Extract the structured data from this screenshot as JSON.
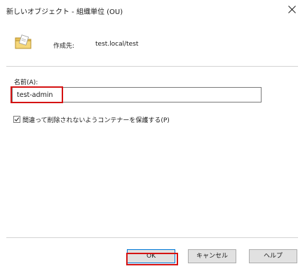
{
  "window": {
    "title": "新しいオブジェクト - 組織単位 (OU)"
  },
  "header": {
    "create_in_label": "作成先:",
    "create_in_path": "test.local/test",
    "icon": "folder-icon"
  },
  "form": {
    "name_label": "名前(A):",
    "name_value": "test-admin",
    "protect_checkbox_label": "間違って削除されないようコンテナーを保護する(P)",
    "protect_checked": true
  },
  "buttons": {
    "ok_label": "OK",
    "cancel_label": "キャンセル",
    "help_label": "ヘルプ"
  },
  "colors": {
    "highlight": "#d51313",
    "focus_border": "#0078d7"
  }
}
